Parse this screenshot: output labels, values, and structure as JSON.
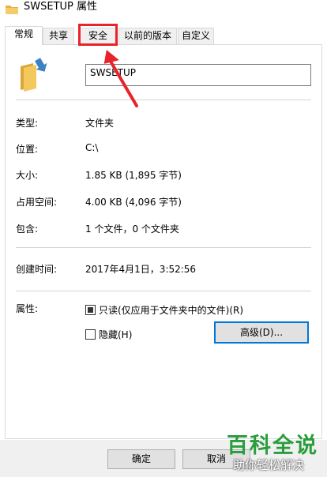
{
  "window": {
    "title": "SWSETUP 属性"
  },
  "tabs": [
    {
      "label": "常规",
      "active": true
    },
    {
      "label": "共享",
      "active": false
    },
    {
      "label": "安全",
      "active": false
    },
    {
      "label": "以前的版本",
      "active": false
    },
    {
      "label": "自定义",
      "active": false
    }
  ],
  "general": {
    "name_value": "SWSETUP",
    "type_label": "类型:",
    "type_value": "文件夹",
    "location_label": "位置:",
    "location_value": "C:\\",
    "size_label": "大小:",
    "size_value": "1.85 KB (1,895 字节)",
    "disk_label": "占用空间:",
    "disk_value": "4.00 KB (4,096 字节)",
    "contains_label": "包含:",
    "contains_value": "1 个文件，0 个文件夹",
    "created_label": "创建时间:",
    "created_value": "2017年4月1日，3:52:56",
    "attributes_label": "属性:",
    "readonly_label": "只读(仅应用于文件夹中的文件)(R)",
    "hidden_label": "隐藏(H)",
    "advanced_label": "高级(D)..."
  },
  "footer": {
    "ok_label": "确定",
    "cancel_label": "取消"
  },
  "watermark": {
    "main": "百科全说",
    "sub": "助你轻松解决"
  },
  "colors": {
    "highlight": "#e8232a",
    "accent": "#0078d7",
    "watermark": "#2a9d3c"
  }
}
